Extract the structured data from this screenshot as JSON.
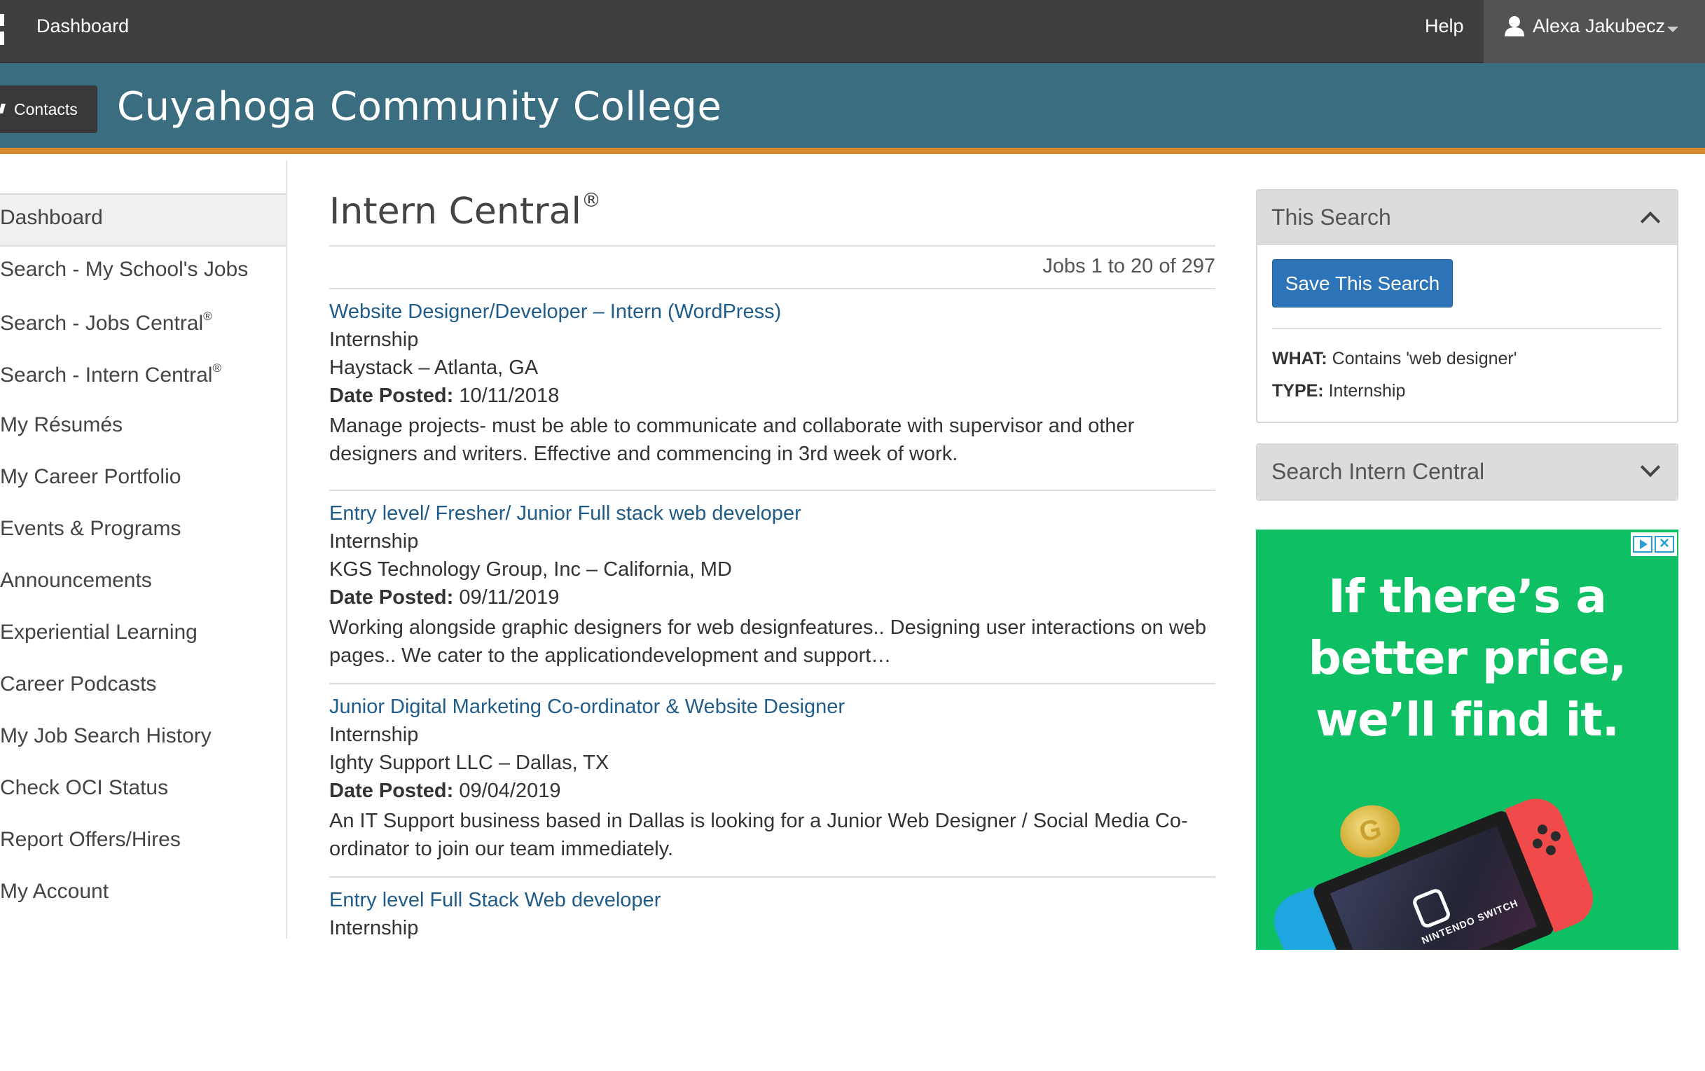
{
  "topbar": {
    "dashboard_link": "Dashboard",
    "help_link": "Help",
    "user_name": "Alexa Jakubecz"
  },
  "header": {
    "contacts_button": "Contacts",
    "college_name": "Cuyahoga Community College"
  },
  "sidebar": {
    "items": [
      {
        "label": "Dashboard",
        "sup": ""
      },
      {
        "label": "Search - My School's Jobs",
        "sup": ""
      },
      {
        "label": "Search - Jobs Central",
        "sup": "®"
      },
      {
        "label": "Search - Intern Central",
        "sup": "®"
      },
      {
        "label": "My Résumés",
        "sup": ""
      },
      {
        "label": "My Career Portfolio",
        "sup": ""
      },
      {
        "label": "Events & Programs",
        "sup": ""
      },
      {
        "label": "Announcements",
        "sup": ""
      },
      {
        "label": "Experiential Learning",
        "sup": ""
      },
      {
        "label": "Career Podcasts",
        "sup": ""
      },
      {
        "label": "My Job Search History",
        "sup": ""
      },
      {
        "label": "Check OCI Status",
        "sup": ""
      },
      {
        "label": "Report Offers/Hires",
        "sup": ""
      },
      {
        "label": "My Account",
        "sup": ""
      }
    ]
  },
  "main": {
    "page_title": "Intern Central",
    "page_title_sup": "®",
    "results_count": "Jobs 1 to 20 of 297",
    "date_label": "Date Posted:",
    "jobs": [
      {
        "title": "Website Designer/Developer – Intern (WordPress)",
        "type": "Internship",
        "company": "Haystack – Atlanta, GA",
        "date": "10/11/2018",
        "description": "Manage projects- must be able to communicate and collaborate with supervisor and other designers and writers. Effective and commencing in 3rd week of work."
      },
      {
        "title": "Entry level/ Fresher/ Junior Full stack web developer",
        "type": "Internship",
        "company": "KGS Technology Group, Inc – California, MD",
        "date": "09/11/2019",
        "description": "Working alongside graphic designers for web designfeatures.. Designing user interactions on web pages.. We cater to the applicationdevelopment and support…"
      },
      {
        "title": "Junior Digital Marketing Co-ordinator & Website Designer",
        "type": "Internship",
        "company": "Ighty Support LLC – Dallas, TX",
        "date": "09/04/2019",
        "description": "An IT Support business based in Dallas is looking for a Junior Web Designer / Social Media Co-ordinator to join our team immediately."
      },
      {
        "title": "Entry level Full Stack Web developer",
        "type": "Internship",
        "company": "",
        "date": "",
        "description": ""
      }
    ]
  },
  "right": {
    "this_search": {
      "title": "This Search",
      "save_button": "Save This Search",
      "what_label": "WHAT:",
      "what_value": "Contains 'web designer'",
      "type_label": "TYPE:",
      "type_value": "Internship"
    },
    "search_panel": {
      "title": "Search Intern Central"
    },
    "ad": {
      "headline_lines": [
        "If there’s a",
        "better price,",
        "we’ll find it."
      ],
      "device_text": "NINTENDO SWITCH",
      "coin_glyph": "G"
    }
  },
  "colors": {
    "topbar": "#3f3f3f",
    "header": "#3a6d80",
    "header_accent": "#d88a2c",
    "link": "#1f5c8a",
    "button": "#2c73b8",
    "ad_green": "#0fbf63"
  }
}
